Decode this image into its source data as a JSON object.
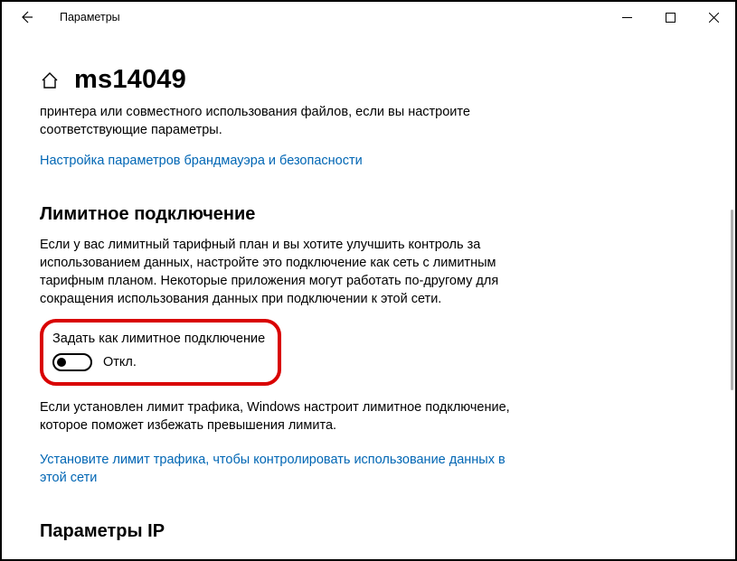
{
  "titlebar": {
    "title": "Параметры"
  },
  "header": {
    "page_title": "ms14049"
  },
  "intro": {
    "text": "принтера или совместного использования файлов, если вы настроите соответствующие параметры.",
    "firewall_link": "Настройка параметров брандмауэра и безопасности"
  },
  "metered": {
    "section_title": "Лимитное подключение",
    "description": "Если у вас лимитный тарифный план и вы хотите улучшить контроль за использованием данных, настройте это подключение как сеть с лимитным тарифным планом. Некоторые приложения могут работать по-другому для сокращения использования данных при подключении к этой сети.",
    "toggle_label": "Задать как лимитное подключение",
    "toggle_state": "Откл.",
    "post_text": "Если установлен лимит трафика, Windows настроит лимитное подключение, которое поможет избежать превышения лимита.",
    "limit_link": "Установите лимит трафика, чтобы контролировать использование данных в этой сети"
  },
  "ip": {
    "section_title": "Параметры IP"
  }
}
